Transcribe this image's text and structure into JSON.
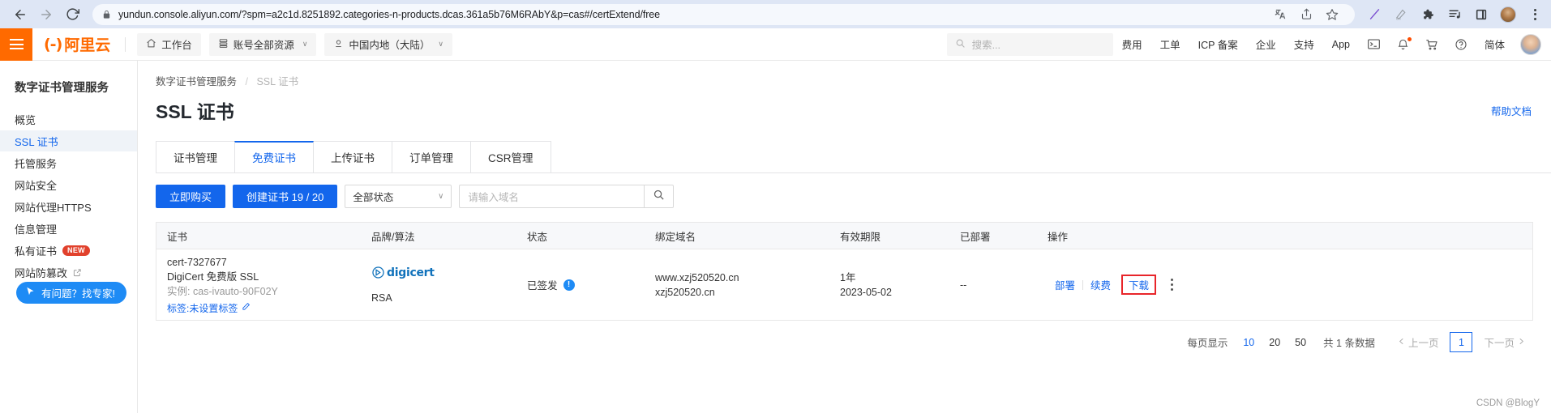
{
  "browser": {
    "back_icon": "back-arrow-icon",
    "forward_icon": "forward-arrow-icon",
    "reload_icon": "reload-icon",
    "lock_icon": "lock-icon",
    "url": "yundun.console.aliyun.com/?spm=a2c1d.8251892.categories-n-products.dcas.361a5b76M6RAbY&p=cas#/certExtend/free",
    "icons": [
      "translate-icon",
      "share-icon",
      "bookmark-star-icon",
      "pen-icon",
      "grammar-icon",
      "extensions-puzzle-icon",
      "media-list-icon",
      "sidebar-panel-icon",
      "profile-avatar-icon",
      "chrome-menu-kebab-icon"
    ]
  },
  "topnav": {
    "menu_icon": "hamburger-menu-icon",
    "logo_mark": "(-)",
    "logo_text": "阿里云",
    "workbench": {
      "icon": "home-icon",
      "label": "工作台"
    },
    "resources": {
      "icon": "resource-icon",
      "label": "账号全部资源",
      "caret": "∨"
    },
    "region": {
      "icon": "location-pin-icon",
      "label": "中国内地（大陆）",
      "caret": "∨"
    },
    "search": {
      "icon": "search-icon",
      "placeholder": "搜索..."
    },
    "links": [
      "费用",
      "工单",
      "ICP 备案",
      "企业",
      "支持",
      "App"
    ],
    "icons": [
      "terminal-icon",
      "bell-notification-icon",
      "shopping-cart-icon",
      "help-circle-icon"
    ],
    "language": "简体",
    "avatar": "user-avatar"
  },
  "sidebar": {
    "title": "数字证书管理服务",
    "items": [
      {
        "label": "概览",
        "active": false
      },
      {
        "label": "SSL 证书",
        "active": true
      },
      {
        "label": "托管服务",
        "active": false
      },
      {
        "label": "网站安全",
        "active": false
      },
      {
        "label": "网站代理HTTPS",
        "active": false
      },
      {
        "label": "信息管理",
        "active": false
      },
      {
        "label": "私有证书",
        "active": false,
        "badge": "NEW"
      },
      {
        "label": "网站防篡改",
        "active": false,
        "external": true
      }
    ],
    "expert_button": {
      "icon": "cursor-pointer-icon",
      "label": "有问题？找专家!"
    }
  },
  "main": {
    "breadcrumb": {
      "parent": "数字证书管理服务",
      "separator": "/",
      "current": "SSL 证书"
    },
    "page_title": "SSL 证书",
    "help_link": "帮助文档",
    "tabs": [
      {
        "label": "证书管理",
        "active": false
      },
      {
        "label": "免费证书",
        "active": true
      },
      {
        "label": "上传证书",
        "active": false
      },
      {
        "label": "订单管理",
        "active": false
      },
      {
        "label": "CSR管理",
        "active": false
      }
    ],
    "toolbar": {
      "buy_now": "立即购买",
      "create_cert": "创建证书 19 / 20",
      "status_filter": {
        "value": "全部状态",
        "caret": "∨"
      },
      "search": {
        "placeholder": "请输入域名",
        "value": "",
        "button_icon": "search-icon"
      }
    },
    "table": {
      "columns": [
        "证书",
        "品牌/算法",
        "状态",
        "绑定域名",
        "有效期限",
        "已部署",
        "操作"
      ],
      "rows": [
        {
          "cert_id": "cert-7327677",
          "cert_name": "DigiCert 免费版 SSL",
          "instance": "实例: cas-ivauto-90F02Y",
          "tag": "标签:未设置标签",
          "tag_edit_icon": "edit-pencil-icon",
          "brand": "digicert",
          "brand_icon": "digicert-logo-icon",
          "algorithm": "RSA",
          "status": "已签发",
          "status_icon": "info-exclamation-icon",
          "domains": [
            "www.xzj520520.cn",
            "xzj520520.cn"
          ],
          "validity_period": "1年",
          "expiry_date": "2023-05-02",
          "deployed": "--",
          "actions": [
            "部署",
            "续费",
            "下载"
          ],
          "highlighted_action": "下载",
          "more_icon": "more-vertical-dots-icon"
        }
      ]
    },
    "pagination": {
      "per_page_label": "每页显示",
      "per_page_options": [
        "10",
        "20",
        "50"
      ],
      "per_page_selected": "10",
      "total": "共 1 条数据",
      "prev": "上一页",
      "prev_icon": "chevron-left-icon",
      "current_page": "1",
      "next": "下一页",
      "next_icon": "chevron-right-icon"
    },
    "watermark": "CSDN @BlogY"
  },
  "colors": {
    "brand_orange": "#ff6a00",
    "accent_blue": "#1366ec",
    "highlight_red": "#e8252a",
    "badge_red": "#e1412c"
  }
}
